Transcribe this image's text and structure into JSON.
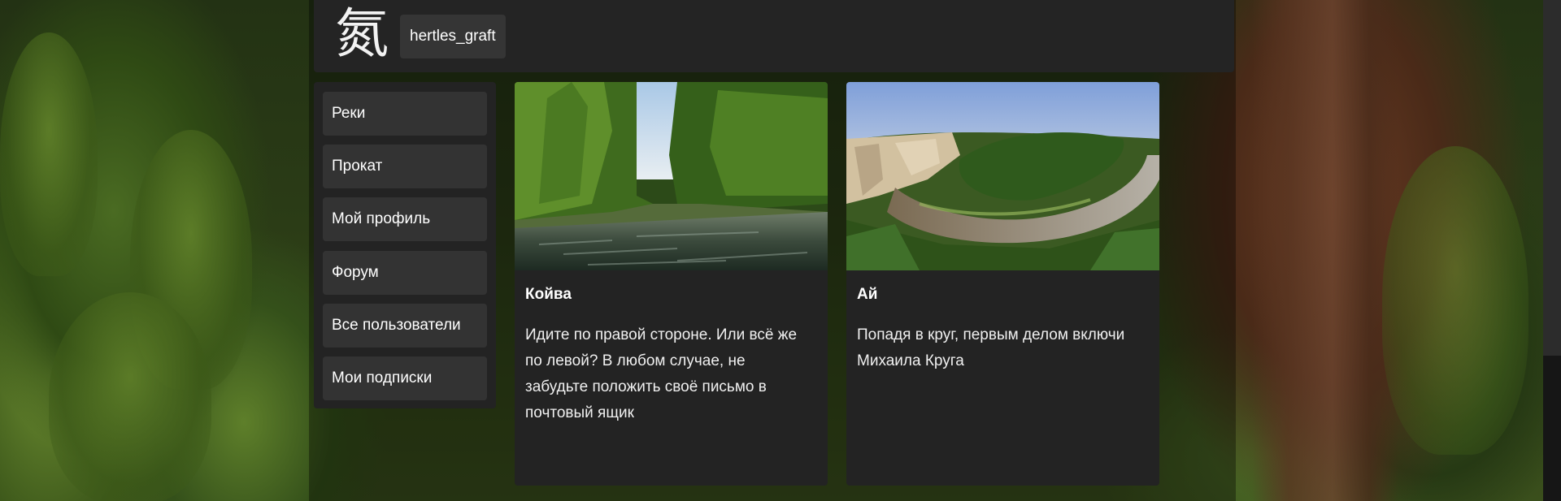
{
  "header": {
    "logo_glyph": "氮",
    "username": "hertles_graft"
  },
  "sidebar": {
    "items": [
      {
        "label": "Реки"
      },
      {
        "label": "Прокат"
      },
      {
        "label": "Мой профиль"
      },
      {
        "label": "Форум"
      },
      {
        "label": "Все пользователи"
      },
      {
        "label": "Мои подписки"
      }
    ]
  },
  "cards": [
    {
      "title": "Койва",
      "text": "Идите по правой стороне. Или всё же по левой? В любом случае, не забудьте положить своё письмо в почтовый ящик",
      "image": "river-forest-photo"
    },
    {
      "title": "Ай",
      "text": "Попадя в круг, первым делом включи Михаила Круга",
      "image": "river-bend-cliffs-photo"
    }
  ],
  "theme": {
    "panel_color": "#242424",
    "button_color": "#333333",
    "text_color": "#ffffff"
  }
}
